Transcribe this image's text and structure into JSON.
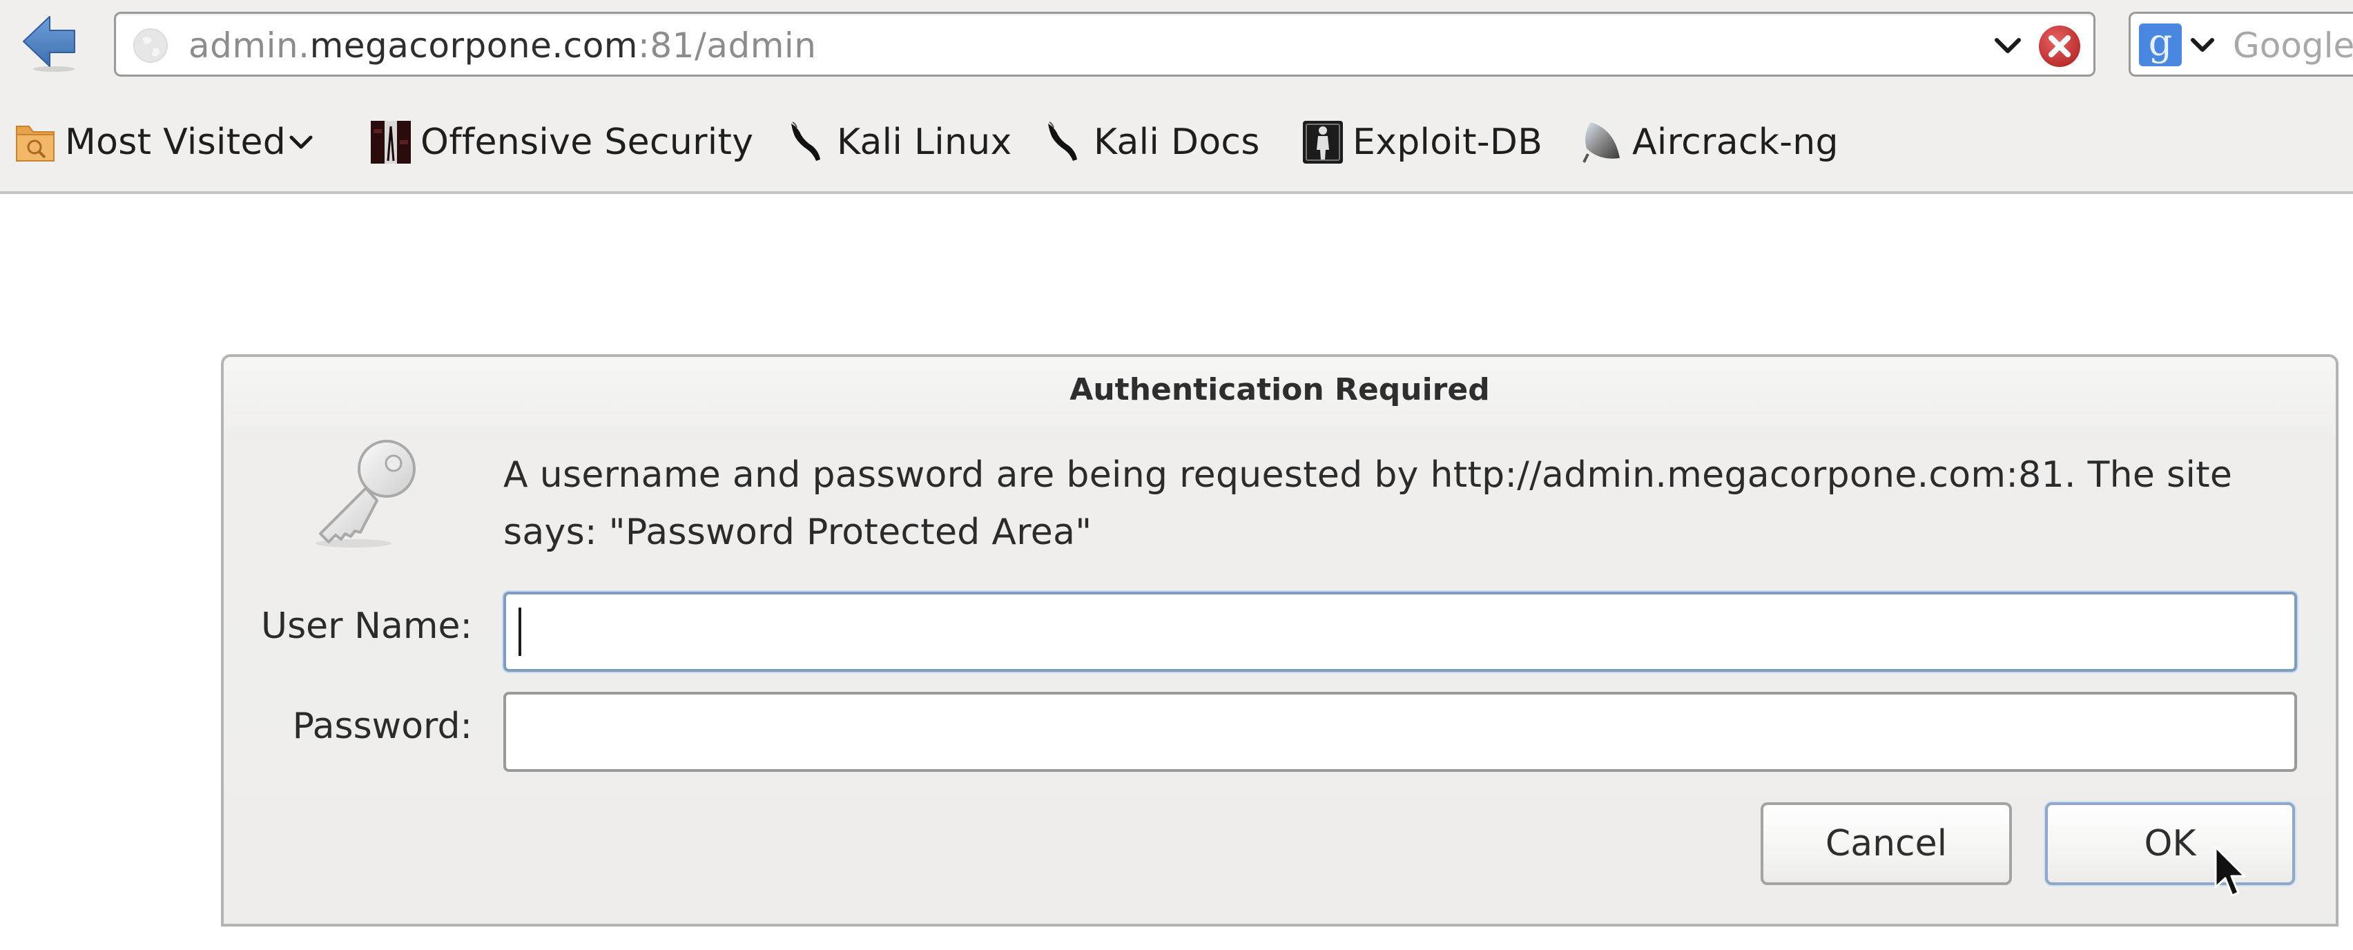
{
  "browser": {
    "back_button_icon": "back-arrow-icon",
    "url": {
      "prefix": "admin.",
      "host": "megacorpone.com",
      "suffix": ":81/admin"
    },
    "site_identity_icon": "globe-icon",
    "url_dropdown_icon": "chevron-down-icon",
    "stop_icon": "stop-x-icon",
    "search": {
      "engine_icon": "google-icon",
      "engine_glyph": "g",
      "placeholder": "Google"
    },
    "colors": {
      "back_arrow": "#4a7fc1",
      "stop_button": "#cc3b3b",
      "search_engine": "#4a87e0",
      "toolbar_bg": "#f0efed"
    }
  },
  "bookmarks": [
    {
      "label": "Most Visited",
      "icon": "folder-icon",
      "has_dropdown": true
    },
    {
      "label": "Offensive Security",
      "icon": "offensive-security-icon"
    },
    {
      "label": "Kali Linux",
      "icon": "kali-dragon-icon"
    },
    {
      "label": "Kali Docs",
      "icon": "kali-dragon-icon"
    },
    {
      "label": "Exploit-DB",
      "icon": "exploit-db-icon"
    },
    {
      "label": "Aircrack-ng",
      "icon": "aircrack-icon"
    }
  ],
  "dialog": {
    "title": "Authentication Required",
    "icon": "key-icon",
    "message_line1": "A username and password are being requested by http://admin.megacorpone.com:81. The site",
    "message_line2": "says: \"Password Protected Area\"",
    "username_label": "User Name:",
    "username_value": "",
    "password_label": "Password:",
    "password_value": "",
    "cancel_label": "Cancel",
    "ok_label": "OK"
  }
}
